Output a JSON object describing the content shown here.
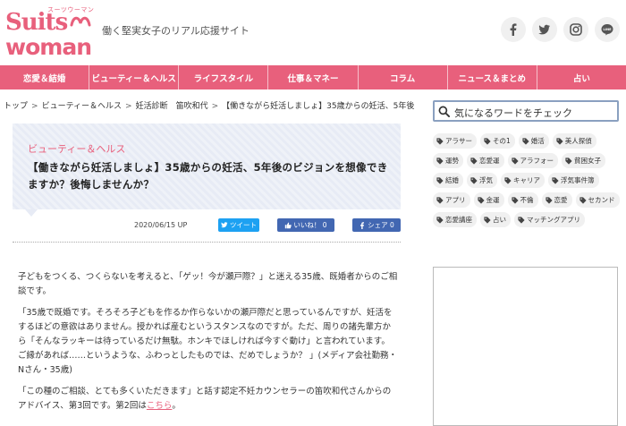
{
  "header": {
    "logo_small": "スーツウーマン",
    "logo_top": "Suits",
    "logo_bottom": "woman",
    "tagline": "働く堅実女子のリアル応援サイト",
    "social": [
      "facebook-icon",
      "twitter-icon",
      "instagram-icon",
      "line-icon"
    ],
    "line_label": "LINE"
  },
  "nav": {
    "items": [
      "恋愛＆結婚",
      "ビューティー＆ヘルス",
      "ライフスタイル",
      "仕事＆マネー",
      "コラム",
      "ニュース＆まとめ",
      "占い"
    ]
  },
  "breadcrumb": [
    "トップ",
    "ビューティー＆ヘルス",
    "妊活診断　笛吹和代",
    "【働きながら妊活しましょ】35歳からの妊活、5年後..."
  ],
  "article": {
    "category": "ビューティー＆ヘルス",
    "title": "【働きながら妊活しましょ】35歳からの妊活、5年後のビジョンを想像できますか？後悔しませんか？",
    "date": "2020/06/15",
    "date_suffix": "UP",
    "tweet_label": "ツイート",
    "like_label": "いいね！ 0",
    "share_label": "シェア 0",
    "paragraphs": [
      "子どもをつくる、つくらないを考えると、「ゲッ！今が瀬戸際？」と迷える35歳、既婚者からのご相談です。",
      "「35歳で既婚です。そろそろ子どもを作るか作らないかの瀬戸際だと思っているんですが、妊活をするほどの意欲はありません。授かれば産むというスタンスなのですが。ただ、周りの諸先輩方から「そんなラッキーは待っているだけ無駄。ホンキでほしければ今すぐ動け」と言われています。ご縁があれば……というような、ふわっとしたものでは、だめでしょうか？ 」(メディア会社勤務・Nさん・35歳)",
      "「この種のご相談、とても多くいただきます」と話す認定不妊カウンセラーの笛吹和代さんからのアドバイス、第3回です。第2回は"
    ],
    "link_text": "こちら",
    "link_tail": "。"
  },
  "sidebar": {
    "search_placeholder": "気になるワードをチェック",
    "tags": [
      "アラサー",
      "その1",
      "婚活",
      "美人探偵",
      "運勢",
      "恋愛運",
      "アラフォー",
      "貧困女子",
      "結婚",
      "浮気",
      "キャリア",
      "浮気事件簿",
      "アプリ",
      "金運",
      "不倫",
      "恋愛",
      "セカンド",
      "恋愛講座",
      "占い",
      "マッチングアプリ"
    ]
  },
  "colors": {
    "brand_pink": "#e8607c",
    "twitter_blue": "#1da1f2",
    "facebook_blue": "#4267b2"
  }
}
